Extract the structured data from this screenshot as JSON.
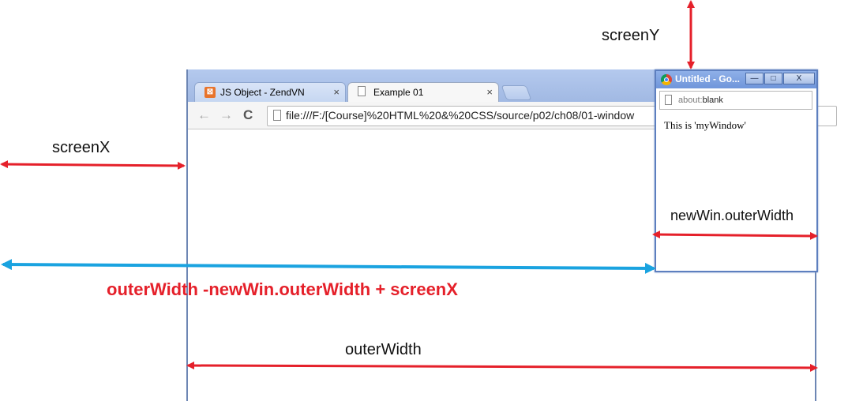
{
  "main_browser": {
    "tabs": [
      {
        "label": "JS Object - ZendVN",
        "close": "×",
        "favicon": "xampp-icon"
      },
      {
        "label": "Example 01",
        "close": "×",
        "favicon": "page-icon"
      }
    ],
    "nav": {
      "back": "←",
      "forward": "→",
      "reload": "C"
    },
    "url": "file:///F:/[Course]%20HTML%20&%20CSS/source/p02/ch08/01-window"
  },
  "popup": {
    "title": "Untitled - Go...",
    "buttons": {
      "minimize": "—",
      "maximize": "□",
      "close": "X"
    },
    "address_scheme": "about:",
    "address_path": "blank",
    "body_text": "This is 'myWindow'"
  },
  "annotations": {
    "screenY": "screenY",
    "screenX": "screenX",
    "newWinOuterWidth": "newWin.outerWidth",
    "formula": "outerWidth -newWin.outerWidth + screenX",
    "outerWidth": "outerWidth"
  },
  "colors": {
    "red_arrow": "#e5202a",
    "blue_arrow": "#1aa3e0",
    "formula_text": "#e5202a"
  }
}
